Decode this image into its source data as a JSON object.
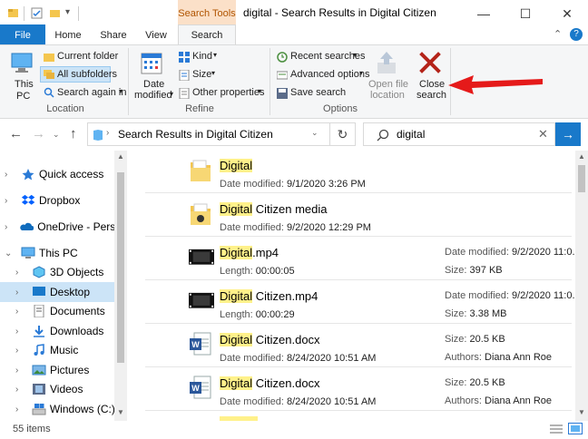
{
  "window": {
    "title": "digital - Search Results in Digital Citizen",
    "context_tab": "Search Tools",
    "controls": [
      "—",
      "☐",
      "✕"
    ]
  },
  "tabs": {
    "file": "File",
    "home": "Home",
    "share": "Share",
    "view": "View",
    "search": "Search"
  },
  "ribbon": {
    "location": {
      "this_pc": "This PC",
      "this_pc_line1": "This",
      "this_pc_line2": "PC",
      "current_folder": "Current folder",
      "all_subfolders": "All subfolders",
      "search_again_in": "Search again in",
      "group_label": "Location"
    },
    "refine": {
      "date_modified_line1": "Date",
      "date_modified_line2": "modified",
      "kind": "Kind",
      "size": "Size",
      "other_properties": "Other properties",
      "group_label": "Refine"
    },
    "options": {
      "recent_searches": "Recent searches",
      "advanced_options": "Advanced options",
      "save_search": "Save search",
      "open_file_location_line1": "Open file",
      "open_file_location_line2": "location",
      "close_search_line1": "Close",
      "close_search_line2": "search",
      "group_label": "Options"
    }
  },
  "address": {
    "path": "Search Results in Digital Citizen",
    "search_query": "digital"
  },
  "nav": [
    {
      "label": "Quick access",
      "icon": "star-icon",
      "indent": 0
    },
    {
      "label": "Dropbox",
      "icon": "dropbox-icon",
      "indent": 0
    },
    {
      "label": "OneDrive - Person",
      "icon": "onedrive-icon",
      "indent": 0
    },
    {
      "label": "This PC",
      "icon": "pc-icon",
      "indent": 0
    },
    {
      "label": "3D Objects",
      "icon": "3d-objects-icon",
      "indent": 1
    },
    {
      "label": "Desktop",
      "icon": "desktop-icon",
      "indent": 1
    },
    {
      "label": "Documents",
      "icon": "documents-icon",
      "indent": 1
    },
    {
      "label": "Downloads",
      "icon": "downloads-icon",
      "indent": 1
    },
    {
      "label": "Music",
      "icon": "music-icon",
      "indent": 1
    },
    {
      "label": "Pictures",
      "icon": "pictures-icon",
      "indent": 1
    },
    {
      "label": "Videos",
      "icon": "videos-icon",
      "indent": 1
    },
    {
      "label": "Windows (C:)",
      "icon": "drive-icon",
      "indent": 1
    }
  ],
  "results": [
    {
      "highlight": "Digital",
      "rest": "",
      "type": "folder",
      "sub_label": "Date modified:",
      "sub_value": "9/1/2020 3:26 PM"
    },
    {
      "highlight": "Digital",
      "rest": " Citizen media",
      "type": "folder-media",
      "sub_label": "Date modified:",
      "sub_value": "9/2/2020 12:29 PM"
    },
    {
      "highlight": "Digital",
      "rest": ".mp4",
      "type": "video",
      "sub_label": "Length:",
      "sub_value": "00:00:05",
      "r1_label": "Date modified:",
      "r1_value": "9/2/2020 11:0...",
      "r2_label": "Size:",
      "r2_value": "397 KB"
    },
    {
      "highlight": "Digital",
      "rest": " Citizen.mp4",
      "type": "video",
      "sub_label": "Length:",
      "sub_value": "00:00:29",
      "r1_label": "Date modified:",
      "r1_value": "9/2/2020 11:0...",
      "r2_label": "Size:",
      "r2_value": "3.38 MB"
    },
    {
      "highlight": "Digital",
      "rest": " Citizen.docx",
      "type": "word",
      "sub_label": "Date modified:",
      "sub_value": "8/24/2020 10:51 AM",
      "r1_label": "Size:",
      "r1_value": "20.5 KB",
      "r2_label": "Authors:",
      "r2_value": "Diana Ann Roe"
    },
    {
      "highlight": "Digital",
      "rest": " Citizen.docx",
      "type": "word",
      "sub_label": "Date modified:",
      "sub_value": "8/24/2020 10:51 AM",
      "r1_label": "Size:",
      "r1_value": "20.5 KB",
      "r2_label": "Authors:",
      "r2_value": "Diana Ann Roe"
    }
  ],
  "status": {
    "items": "55 items"
  },
  "colors": {
    "accent": "#1979ca",
    "highlight": "#fff18a",
    "close_x": "#c42b1c",
    "arrow": "#e51a1a",
    "context_tab": "#fbe0c8"
  }
}
